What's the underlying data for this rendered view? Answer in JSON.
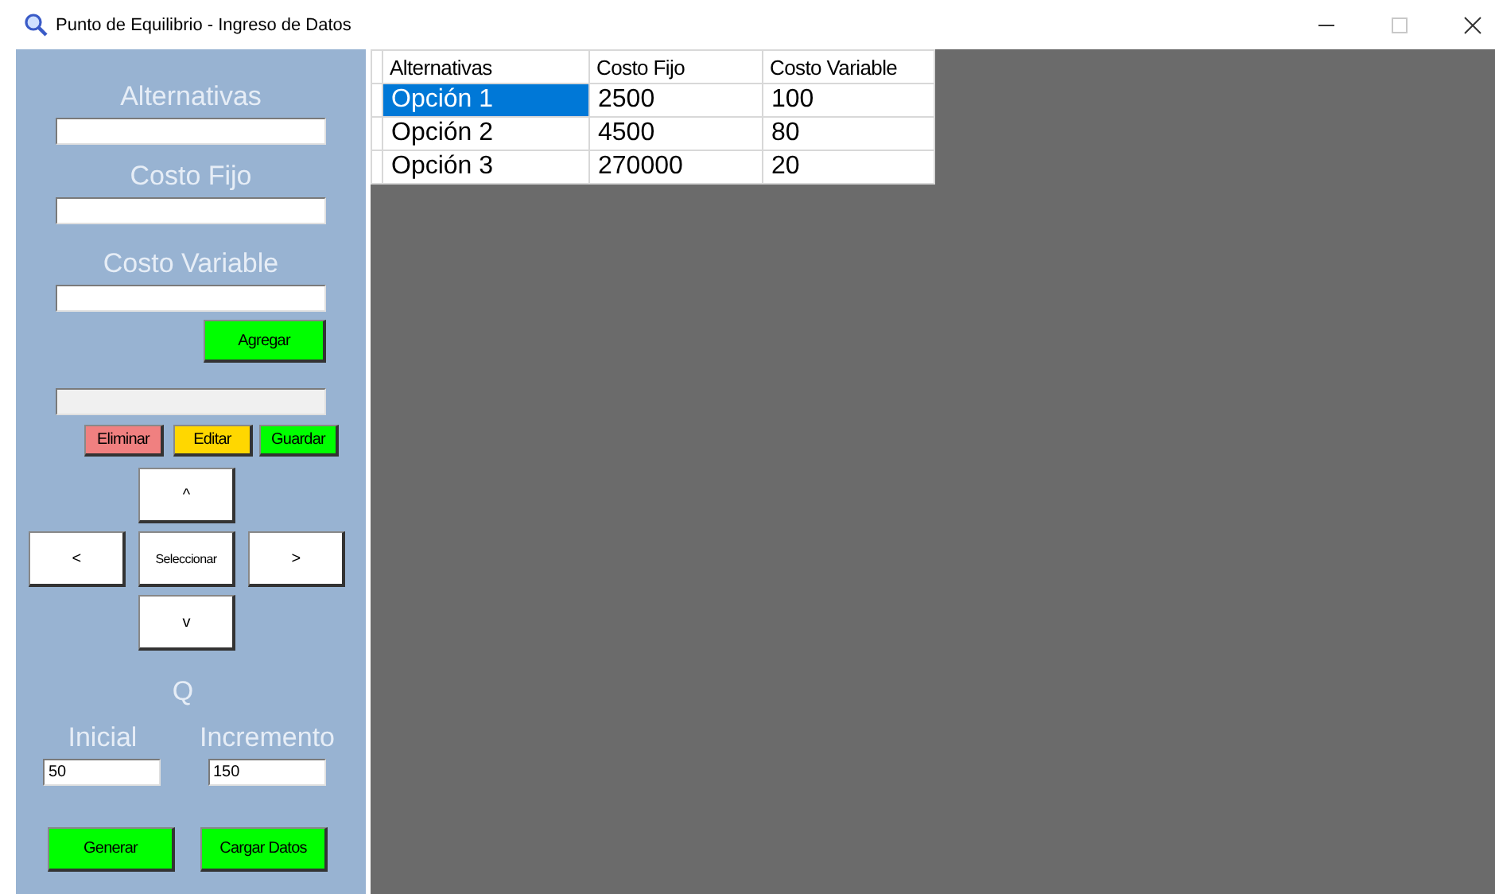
{
  "window": {
    "title": "Punto de Equilibrio - Ingreso de Datos",
    "maximize_disabled": true
  },
  "entry_fields": [
    {
      "label": "Alternativas"
    },
    {
      "label": "Costo Fijo"
    },
    {
      "label": "Costo Variable"
    }
  ],
  "add_button": "Agregar",
  "selection_field": {
    "disabled": true
  },
  "edit_buttons": [
    {
      "label": "Eliminar",
      "color": "#f08080"
    },
    {
      "label": "Editar",
      "color": "#ffd700"
    },
    {
      "label": "Guardar",
      "color": "#00ff00"
    }
  ],
  "nav_buttons": {
    "up": "^",
    "left": "<",
    "center": "Seleccionar",
    "right": ">",
    "down": "v"
  },
  "q": {
    "label": "Q",
    "fields": [
      {
        "label": "Inicial",
        "value": "50"
      },
      {
        "label": "Incremento",
        "value": "150"
      }
    ]
  },
  "bottom_buttons": [
    "Generar",
    "Cargar Datos"
  ],
  "table": {
    "columns": [
      "Alternativas",
      "Costo Fijo",
      "Costo Variable"
    ],
    "rows": [
      {
        "cells": [
          "Opción 1",
          "2500",
          "100"
        ],
        "selected": true
      },
      {
        "cells": [
          "Opción 2",
          "4500",
          "80"
        ],
        "selected": false
      },
      {
        "cells": [
          "Opción 3",
          "270000",
          "20"
        ],
        "selected": false
      }
    ]
  }
}
